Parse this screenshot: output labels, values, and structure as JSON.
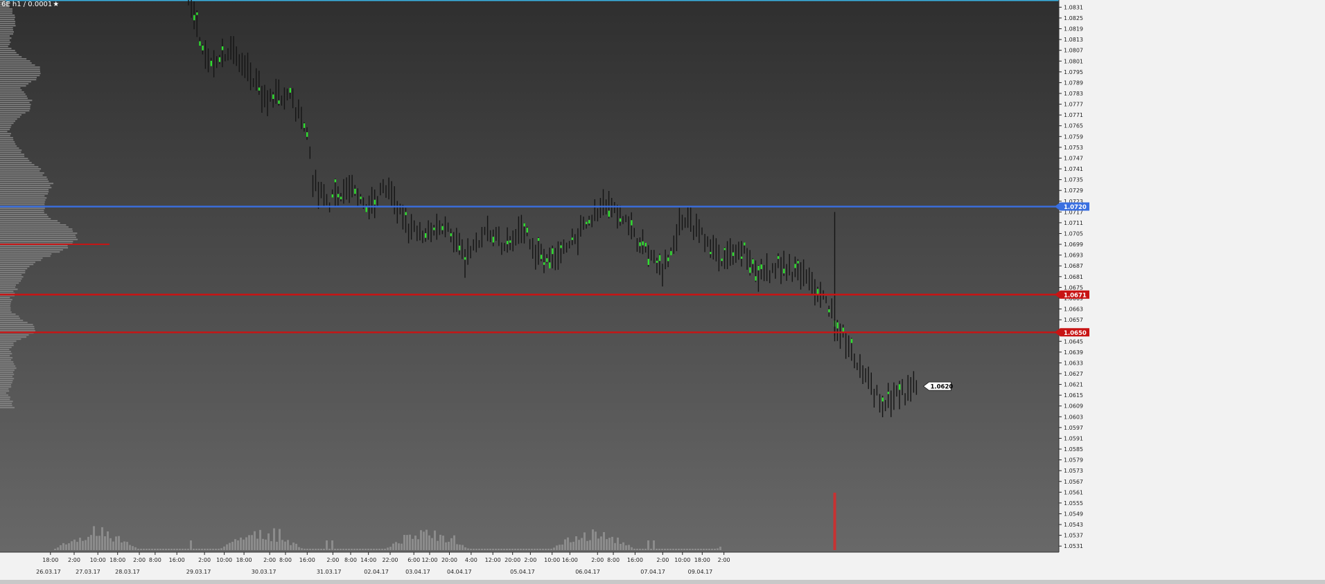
{
  "title": "6E h1 / 0.0001",
  "favorite_icon": "star-icon",
  "colors": {
    "bg_top": "#2f2f2f",
    "bg_bottom": "#686868",
    "axis_bg": "#f2f2f2",
    "bar": "#141414",
    "bar_up": "#2fe02f",
    "bar_red": "#e0301e",
    "profile": "#8a8a8a",
    "volume": "#8c8c8c",
    "volume_spike": "#c83232",
    "level_blue": "#3a6fe0",
    "level_red": "#c81414",
    "price_tag_bg": "#ffffff"
  },
  "chart_data": {
    "type": "bar",
    "title": "6E h1 / 0.0001",
    "price_axis": {
      "ylim": [
        1.0528,
        1.0835
      ],
      "ticks": [
        "1.0831",
        "1.0825",
        "1.0819",
        "1.0813",
        "1.0807",
        "1.0801",
        "1.0795",
        "1.0789",
        "1.0783",
        "1.0777",
        "1.0771",
        "1.0765",
        "1.0759",
        "1.0753",
        "1.0747",
        "1.0741",
        "1.0735",
        "1.0729",
        "1.0723",
        "1.0717",
        "1.0711",
        "1.0705",
        "1.0699",
        "1.0693",
        "1.0687",
        "1.0681",
        "1.0675",
        "1.0669",
        "1.0663",
        "1.0657",
        "1.0651",
        "1.0645",
        "1.0639",
        "1.0633",
        "1.0627",
        "1.0621",
        "1.0615",
        "1.0609",
        "1.0603",
        "1.0597",
        "1.0591",
        "1.0585",
        "1.0579",
        "1.0573",
        "1.0567",
        "1.0561",
        "1.0555",
        "1.0549",
        "1.0543",
        "1.0537",
        "1.0531"
      ]
    },
    "time_axis": {
      "hour_labels": [
        {
          "label": "18:00",
          "slot": 0.8
        },
        {
          "label": "2:00",
          "slot": 2.0
        },
        {
          "label": "10:00",
          "slot": 3.2
        },
        {
          "label": "18:00",
          "slot": 4.2
        },
        {
          "label": "2:00",
          "slot": 5.3
        },
        {
          "label": "8:00",
          "slot": 6.1
        },
        {
          "label": "16:00",
          "slot": 7.2
        },
        {
          "label": "2:00",
          "slot": 8.6
        },
        {
          "label": "10:00",
          "slot": 9.6
        },
        {
          "label": "18:00",
          "slot": 10.6
        },
        {
          "label": "2:00",
          "slot": 11.9
        },
        {
          "label": "8:00",
          "slot": 12.7
        },
        {
          "label": "16:00",
          "slot": 13.8
        },
        {
          "label": "2:00",
          "slot": 15.1
        },
        {
          "label": "8:00",
          "slot": 16.0
        },
        {
          "label": "14:00",
          "slot": 16.9
        },
        {
          "label": "22:00",
          "slot": 18.0
        },
        {
          "label": "6:00",
          "slot": 19.2
        },
        {
          "label": "12:00",
          "slot": 20.0
        },
        {
          "label": "20:00",
          "slot": 21.0
        },
        {
          "label": "4:00",
          "slot": 22.1
        },
        {
          "label": "12:00",
          "slot": 23.2
        },
        {
          "label": "20:00",
          "slot": 24.2
        },
        {
          "label": "2:00",
          "slot": 25.1
        },
        {
          "label": "10:00",
          "slot": 26.2
        },
        {
          "label": "16:00",
          "slot": 27.1
        },
        {
          "label": "2:00",
          "slot": 28.5
        },
        {
          "label": "8:00",
          "slot": 29.3
        },
        {
          "label": "16:00",
          "slot": 30.4
        },
        {
          "label": "2:00",
          "slot": 31.8
        },
        {
          "label": "10:00",
          "slot": 32.8
        },
        {
          "label": "18:00",
          "slot": 33.8
        },
        {
          "label": "2:00",
          "slot": 34.9
        }
      ],
      "date_labels": [
        {
          "label": "26.03.17",
          "slot": 0.7
        },
        {
          "label": "27.03.17",
          "slot": 2.7
        },
        {
          "label": "28.03.17",
          "slot": 4.7
        },
        {
          "label": "29.03.17",
          "slot": 8.3
        },
        {
          "label": "30.03.17",
          "slot": 11.6
        },
        {
          "label": "31.03.17",
          "slot": 14.9
        },
        {
          "label": "02.04.17",
          "slot": 17.3
        },
        {
          "label": "03.04.17",
          "slot": 19.4
        },
        {
          "label": "04.04.17",
          "slot": 21.5
        },
        {
          "label": "05.04.17",
          "slot": 24.7
        },
        {
          "label": "06.04.17",
          "slot": 28.0
        },
        {
          "label": "07.04.17",
          "slot": 31.3
        },
        {
          "label": "09.04.17",
          "slot": 33.7
        }
      ]
    },
    "levels": [
      {
        "price": 1.072,
        "label": "1.0720",
        "color": "blue"
      },
      {
        "price": 1.0671,
        "label": "1.0671",
        "color": "red"
      },
      {
        "price": 1.065,
        "label": "1.0650",
        "color": "red"
      }
    ],
    "last_price": {
      "price": 1.062,
      "label": "1.0620"
    },
    "price_path": [
      [
        0,
        1.0835
      ],
      [
        1,
        1.08
      ],
      [
        2,
        1.0808
      ],
      [
        3,
        1.0795
      ],
      [
        4,
        1.0778
      ],
      [
        5,
        1.0785
      ],
      [
        6,
        1.076
      ],
      [
        6.3,
        1.0735
      ],
      [
        7,
        1.0721
      ],
      [
        8,
        1.073
      ],
      [
        9,
        1.0722
      ],
      [
        10,
        1.073
      ],
      [
        11,
        1.071
      ],
      [
        12,
        1.0702
      ],
      [
        13,
        1.0712
      ],
      [
        14,
        1.069
      ],
      [
        15,
        1.0705
      ],
      [
        16,
        1.0698
      ],
      [
        17,
        1.0706
      ],
      [
        18,
        1.0688
      ],
      [
        19,
        1.0695
      ],
      [
        20,
        1.0708
      ],
      [
        21,
        1.0722
      ],
      [
        22,
        1.0712
      ],
      [
        23,
        1.0698
      ],
      [
        24,
        1.0685
      ],
      [
        25,
        1.0714
      ],
      [
        26,
        1.0706
      ],
      [
        27,
        1.069
      ],
      [
        28,
        1.0695
      ],
      [
        29,
        1.0682
      ],
      [
        30,
        1.0688
      ],
      [
        31,
        1.0682
      ],
      [
        32,
        1.0672
      ],
      [
        33,
        1.065
      ],
      [
        34,
        1.0628
      ],
      [
        35,
        1.0612
      ],
      [
        36,
        1.0615
      ],
      [
        37,
        1.062
      ]
    ],
    "volume_spike": {
      "slot": 33.0,
      "relative_height": 1.0
    }
  }
}
